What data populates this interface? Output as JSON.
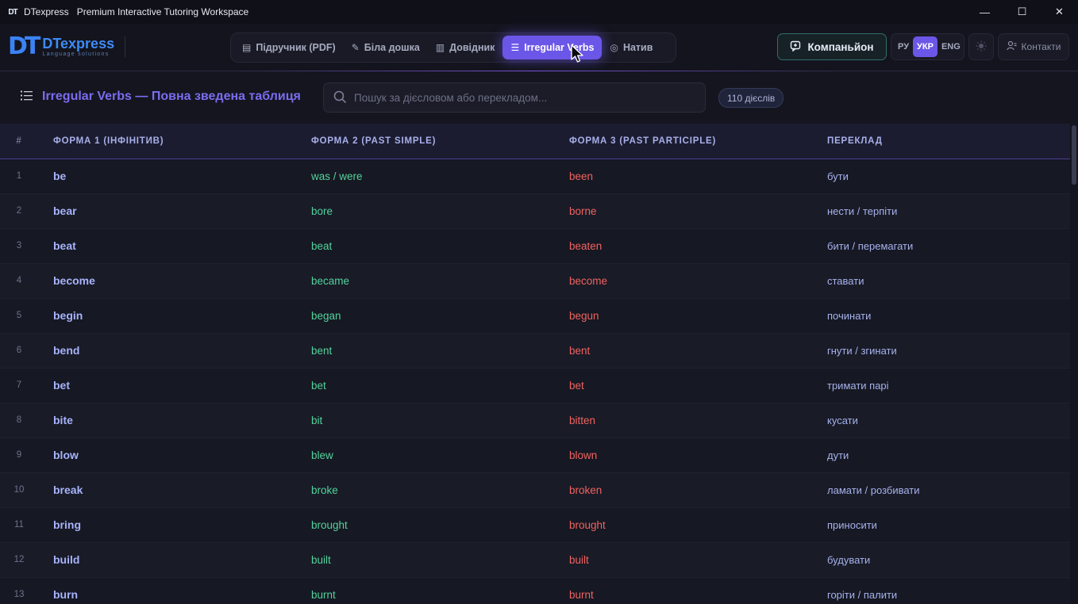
{
  "window": {
    "app_name": "DTexpress",
    "title": "Premium Interactive Tutoring Workspace",
    "logo_text": "DT",
    "controls": {
      "minimize": "—",
      "maximize": "☐",
      "close": "✕"
    }
  },
  "brand": {
    "mark": "DT",
    "name": "DTexpress",
    "tagline": "Language solutions"
  },
  "nav": {
    "items": [
      {
        "label": "Підручник (PDF)",
        "icon": "book-icon",
        "glyph": "▤"
      },
      {
        "label": "Біла дошка",
        "icon": "whiteboard-icon",
        "glyph": "✎"
      },
      {
        "label": "Довідник",
        "icon": "handbook-icon",
        "glyph": "▥"
      },
      {
        "label": "Irregular Verbs",
        "icon": "list-icon",
        "glyph": "☰",
        "active": true
      },
      {
        "label": "Натив",
        "icon": "globe-icon",
        "glyph": "◎"
      }
    ]
  },
  "header_actions": {
    "companion_label": "Компаньйон",
    "companion_icon": "chat-icon",
    "languages": [
      "РУ",
      "УКР",
      "ENG"
    ],
    "active_language": "УКР",
    "theme_icon": "sun-icon",
    "contacts_label": "Контакти",
    "contacts_icon": "user-contacts-icon"
  },
  "toolbar": {
    "title": "Irregular Verbs — Повна зведена таблиця",
    "search_placeholder": "Пошук за дієсловом або перекладом...",
    "search_value": "",
    "count_badge": "110 дієслів"
  },
  "table": {
    "headers": {
      "num": "#",
      "form1": "ФОРМА 1 (ІНФІНІТИВ)",
      "form2": "ФОРМА 2 (PAST SIMPLE)",
      "form3": "ФОРМА 3 (PAST PARTICIPLE)",
      "translation": "ПЕРЕКЛАД"
    },
    "rows": [
      {
        "n": "1",
        "f1": "be",
        "f2": "was / were",
        "f3": "been",
        "tr": "бути"
      },
      {
        "n": "2",
        "f1": "bear",
        "f2": "bore",
        "f3": "borne",
        "tr": "нести / терпіти"
      },
      {
        "n": "3",
        "f1": "beat",
        "f2": "beat",
        "f3": "beaten",
        "tr": "бити / перемагати"
      },
      {
        "n": "4",
        "f1": "become",
        "f2": "became",
        "f3": "become",
        "tr": "ставати"
      },
      {
        "n": "5",
        "f1": "begin",
        "f2": "began",
        "f3": "begun",
        "tr": "починати"
      },
      {
        "n": "6",
        "f1": "bend",
        "f2": "bent",
        "f3": "bent",
        "tr": "гнути / згинати"
      },
      {
        "n": "7",
        "f1": "bet",
        "f2": "bet",
        "f3": "bet",
        "tr": "тримати парі"
      },
      {
        "n": "8",
        "f1": "bite",
        "f2": "bit",
        "f3": "bitten",
        "tr": "кусати"
      },
      {
        "n": "9",
        "f1": "blow",
        "f2": "blew",
        "f3": "blown",
        "tr": "дути"
      },
      {
        "n": "10",
        "f1": "break",
        "f2": "broke",
        "f3": "broken",
        "tr": "ламати / розбивати"
      },
      {
        "n": "11",
        "f1": "bring",
        "f2": "brought",
        "f3": "brought",
        "tr": "приносити"
      },
      {
        "n": "12",
        "f1": "build",
        "f2": "built",
        "f3": "built",
        "tr": "будувати"
      },
      {
        "n": "13",
        "f1": "burn",
        "f2": "burnt",
        "f3": "burnt",
        "tr": "горіти / палити"
      }
    ]
  }
}
